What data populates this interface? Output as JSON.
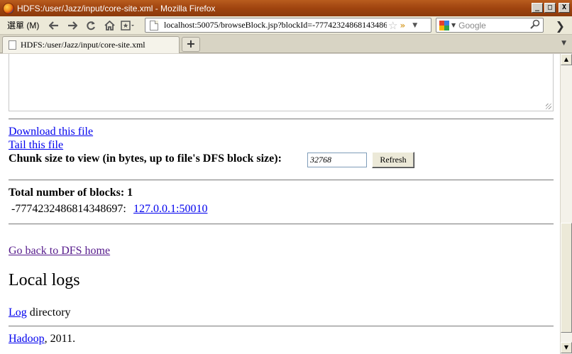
{
  "window": {
    "title": "HDFS:/user/Jazz/input/core-site.xml - Mozilla Firefox",
    "minimize": "_",
    "maximize": "□",
    "close": "X"
  },
  "toolbar": {
    "menu_label": "選單 (M)",
    "url": "localhost:50075/browseBlock.jsp?blockId=-77742324868143486",
    "search_engine": "Google"
  },
  "tabs": [
    {
      "title": "HDFS:/user/Jazz/input/core-site.xml"
    }
  ],
  "page": {
    "download_link": "Download this file",
    "tail_link": "Tail this file",
    "chunk_label": "Chunk size to view (in bytes, up to file's DFS block size):",
    "chunk_value": "32768",
    "refresh_label": "Refresh",
    "total_blocks": "Total number of blocks: 1",
    "block_id": "-7774232486814348697:",
    "datanode_link": "127.0.0.1:50010",
    "back_link": "Go back to DFS home",
    "local_logs_heading": "Local logs",
    "log_link": "Log",
    "log_suffix": " directory",
    "footer_link": "Hadoop",
    "footer_suffix": ", 2011."
  },
  "icons": [
    "firefox-icon",
    "back-icon",
    "forward-icon",
    "reload-icon",
    "home-icon",
    "bookmarks-icon",
    "page-icon",
    "star-icon",
    "search-icon"
  ],
  "colors": {
    "link": "#0000ee",
    "visited": "#551a8b",
    "titlebar": "#a0440f"
  }
}
